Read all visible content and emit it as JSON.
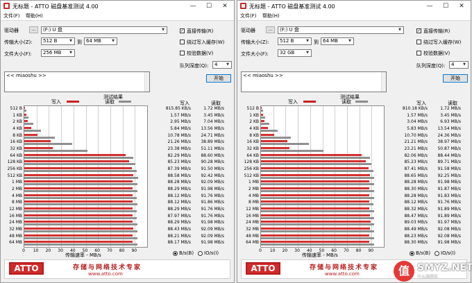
{
  "windows": [
    {
      "title": "无标题 - ATTO 磁盘基准测试 4.00",
      "menu": [
        "文件(F)",
        "帮助(H)"
      ],
      "drive_label": "驱动器",
      "browse_label": "...",
      "drive_value": "(F:) U 盘",
      "transfer_label": "传输大小(Z):",
      "transfer_from": "512 B",
      "to_label": "到",
      "transfer_to": "64 MB",
      "filesize_label": "文件大小(F):",
      "filesize_value": "256 MB",
      "direct_io": {
        "label": "直接传输(R)",
        "checked": true
      },
      "bypass_cache": {
        "label": "绕过写入缓存(W)",
        "checked": false
      },
      "verify": {
        "label": "校验数据(V)",
        "checked": false
      },
      "queue_label": "队列深度(Q):",
      "queue_value": "4",
      "start_label": "开始",
      "description": "<< miaoshu >>",
      "results_title": "测试结果",
      "legend_write": "写入",
      "legend_read": "读取",
      "col_write": "写入",
      "col_read": "读取",
      "xaxis_title": "传输速率 - MB/s",
      "radio_bs": {
        "label": "B/s(B)",
        "selected": true
      },
      "radio_io": {
        "label": "IO/s(I)",
        "selected": false
      },
      "banner_tagline": "存储与网络技术专家",
      "banner_url": "www.atto.com",
      "logo": "ATTO",
      "rows": [
        {
          "size": "512 B",
          "w": "815.85 KB/s",
          "r": "1.72 MB/s"
        },
        {
          "size": "1 KB",
          "w": "1.57 MB/s",
          "r": "3.45 MB/s"
        },
        {
          "size": "2 KB",
          "w": "2.95 MB/s",
          "r": "7.04 MB/s"
        },
        {
          "size": "4 KB",
          "w": "5.84 MB/s",
          "r": "13.56 MB/s"
        },
        {
          "size": "8 KB",
          "w": "10.78 MB/s",
          "r": "24.71 MB/s"
        },
        {
          "size": "16 KB",
          "w": "21.26 MB/s",
          "r": "38.89 MB/s"
        },
        {
          "size": "32 KB",
          "w": "23.38 MB/s",
          "r": "51.11 MB/s"
        },
        {
          "size": "64 KB",
          "w": "82.29 MB/s",
          "r": "88.60 MB/s"
        },
        {
          "size": "128 KB",
          "w": "85.23 MB/s",
          "r": "90.28 MB/s"
        },
        {
          "size": "256 KB",
          "w": "87.39 MB/s",
          "r": "91.50 MB/s"
        },
        {
          "size": "512 KB",
          "w": "88.58 MB/s",
          "r": "92.42 MB/s"
        },
        {
          "size": "1 MB",
          "w": "88.28 MB/s",
          "r": "92.09 MB/s"
        },
        {
          "size": "2 MB",
          "w": "88.29 MB/s",
          "r": "91.98 MB/s"
        },
        {
          "size": "4 MB",
          "w": "88.12 MB/s",
          "r": "91.76 MB/s"
        },
        {
          "size": "8 MB",
          "w": "88.12 MB/s",
          "r": "91.86 MB/s"
        },
        {
          "size": "12 MB",
          "w": "88.29 MB/s",
          "r": "91.76 MB/s"
        },
        {
          "size": "16 MB",
          "w": "87.97 MB/s",
          "r": "91.76 MB/s"
        },
        {
          "size": "24 MB",
          "w": "88.29 MB/s",
          "r": "91.98 MB/s"
        },
        {
          "size": "32 MB",
          "w": "88.43 MB/s",
          "r": "92.09 MB/s"
        },
        {
          "size": "48 MB",
          "w": "88.21 MB/s",
          "r": "92.09 MB/s"
        },
        {
          "size": "64 MB",
          "w": "88.17 MB/s",
          "r": "91.98 MB/s"
        }
      ]
    },
    {
      "title": "无标题 - ATTO 磁盘基准测试 4.00",
      "menu": [
        "文件(F)",
        "帮助(H)"
      ],
      "drive_label": "驱动器",
      "browse_label": "...",
      "drive_value": "(F:) U 盘",
      "transfer_label": "传输大小(Z):",
      "transfer_from": "512 B",
      "to_label": "到",
      "transfer_to": "64 MB",
      "filesize_label": "文件大小(F):",
      "filesize_value": "32 GB",
      "direct_io": {
        "label": "直接传输(R)",
        "checked": true
      },
      "bypass_cache": {
        "label": "绕过写入缓存(W)",
        "checked": false
      },
      "verify": {
        "label": "校验数据(V)",
        "checked": false
      },
      "queue_label": "队列深度(Q):",
      "queue_value": "4",
      "start_label": "开始",
      "description": "<< miaoshu >>",
      "results_title": "测试结果",
      "legend_write": "写入",
      "legend_read": "读取",
      "col_write": "写入",
      "col_read": "读取",
      "xaxis_title": "传输速率 - MB/s",
      "radio_bs": {
        "label": "B/s(B)",
        "selected": true
      },
      "radio_io": {
        "label": "IO/s(I)",
        "selected": false
      },
      "banner_tagline": "存储与网络技术专家",
      "banner_url": "www.atto.com",
      "logo": "ATTO",
      "rows": [
        {
          "size": "512 B",
          "w": "810.18 KB/s",
          "r": "1.72 MB/s"
        },
        {
          "size": "1 KB",
          "w": "1.57 MB/s",
          "r": "3.45 MB/s"
        },
        {
          "size": "2 KB",
          "w": "3.04 MB/s",
          "r": "6.93 MB/s"
        },
        {
          "size": "4 KB",
          "w": "5.83 MB/s",
          "r": "13.54 MB/s"
        },
        {
          "size": "8 KB",
          "w": "10.70 MB/s",
          "r": "24.36 MB/s"
        },
        {
          "size": "16 KB",
          "w": "21.21 MB/s",
          "r": "38.97 MB/s"
        },
        {
          "size": "32 KB",
          "w": "23.21 MB/s",
          "r": "50.87 MB/s"
        },
        {
          "size": "64 KB",
          "w": "82.06 MB/s",
          "r": "88.44 MB/s"
        },
        {
          "size": "128 KB",
          "w": "85.23 MB/s",
          "r": "89.71 MB/s"
        },
        {
          "size": "256 KB",
          "w": "87.41 MB/s",
          "r": "91.58 MB/s"
        },
        {
          "size": "512 KB",
          "w": "88.65 MB/s",
          "r": "92.25 MB/s"
        },
        {
          "size": "1 MB",
          "w": "88.28 MB/s",
          "r": "91.98 MB/s"
        },
        {
          "size": "2 MB",
          "w": "88.30 MB/s",
          "r": "91.87 MB/s"
        },
        {
          "size": "4 MB",
          "w": "88.28 MB/s",
          "r": "91.83 MB/s"
        },
        {
          "size": "8 MB",
          "w": "88.12 MB/s",
          "r": "91.76 MB/s"
        },
        {
          "size": "12 MB",
          "w": "88.32 MB/s",
          "r": "91.89 MB/s"
        },
        {
          "size": "16 MB",
          "w": "88.47 MB/s",
          "r": "91.89 MB/s"
        },
        {
          "size": "24 MB",
          "w": "89.03 MB/s",
          "r": "91.97 MB/s"
        },
        {
          "size": "32 MB",
          "w": "88.49 MB/s",
          "r": "92.08 MB/s"
        },
        {
          "size": "48 MB",
          "w": "88.23 MB/s",
          "r": "92.08 MB/s"
        },
        {
          "size": "64 MB",
          "w": "88.30 MB/s",
          "r": "91.98 MB/s"
        }
      ]
    }
  ],
  "chart_data": [
    {
      "type": "bar",
      "orientation": "horizontal",
      "xlabel": "传输速率 - MB/s",
      "xlim": [
        0,
        100
      ],
      "xticks": [
        0,
        10,
        20,
        30,
        40,
        50,
        60,
        70,
        80,
        90
      ],
      "categories": [
        "512 B",
        "1 KB",
        "2 KB",
        "4 KB",
        "8 KB",
        "16 KB",
        "32 KB",
        "64 KB",
        "128 KB",
        "256 KB",
        "512 KB",
        "1 MB",
        "2 MB",
        "4 MB",
        "8 MB",
        "12 MB",
        "16 MB",
        "24 MB",
        "32 MB",
        "48 MB",
        "64 MB"
      ],
      "series": [
        {
          "name": "写入",
          "color": "#d32f2f",
          "values": [
            0.8,
            1.57,
            2.95,
            5.84,
            10.78,
            21.26,
            23.38,
            82.29,
            85.23,
            87.39,
            88.58,
            88.28,
            88.29,
            88.12,
            88.12,
            88.29,
            87.97,
            88.29,
            88.43,
            88.21,
            88.17
          ]
        },
        {
          "name": "读取",
          "color": "#8f8f8f",
          "values": [
            1.72,
            3.45,
            7.04,
            13.56,
            24.71,
            38.89,
            51.11,
            88.6,
            90.28,
            91.5,
            92.42,
            92.09,
            91.98,
            91.76,
            91.86,
            91.76,
            91.76,
            91.98,
            92.09,
            92.09,
            91.98
          ]
        }
      ]
    },
    {
      "type": "bar",
      "orientation": "horizontal",
      "xlabel": "传输速率 - MB/s",
      "xlim": [
        0,
        100
      ],
      "xticks": [
        0,
        10,
        20,
        30,
        40,
        50,
        60,
        70,
        80,
        90
      ],
      "categories": [
        "512 B",
        "1 KB",
        "2 KB",
        "4 KB",
        "8 KB",
        "16 KB",
        "32 KB",
        "64 KB",
        "128 KB",
        "256 KB",
        "512 KB",
        "1 MB",
        "2 MB",
        "4 MB",
        "8 MB",
        "12 MB",
        "16 MB",
        "24 MB",
        "32 MB",
        "48 MB",
        "64 MB"
      ],
      "series": [
        {
          "name": "写入",
          "color": "#d32f2f",
          "values": [
            0.79,
            1.57,
            3.04,
            5.83,
            10.7,
            21.21,
            23.21,
            82.06,
            85.23,
            87.41,
            88.65,
            88.28,
            88.3,
            88.28,
            88.12,
            88.32,
            88.47,
            89.03,
            88.49,
            88.23,
            88.3
          ]
        },
        {
          "name": "读取",
          "color": "#8f8f8f",
          "values": [
            1.72,
            3.45,
            6.93,
            13.54,
            24.36,
            38.97,
            50.87,
            88.44,
            89.71,
            91.58,
            92.25,
            91.98,
            91.87,
            91.83,
            91.76,
            91.89,
            91.89,
            91.97,
            92.08,
            92.08,
            91.98
          ]
        }
      ]
    }
  ],
  "watermark": {
    "logo": "值",
    "text": "SMYZ.NET",
    "sub": "什么值得买"
  }
}
